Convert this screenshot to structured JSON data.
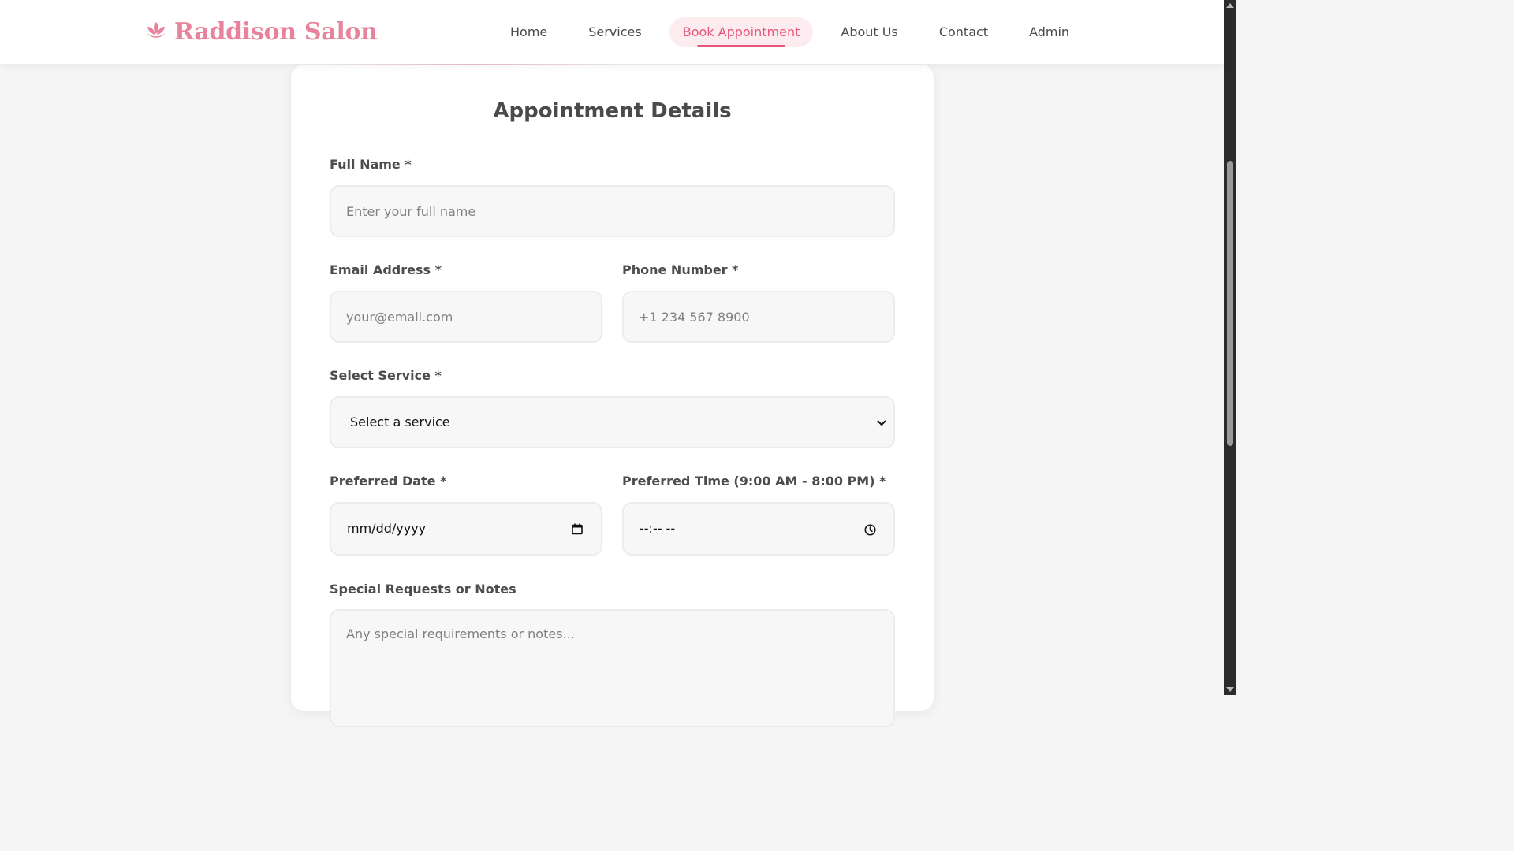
{
  "brand": {
    "name": "Raddison Salon",
    "icon": "lotus-icon",
    "color": "#e8839c"
  },
  "nav": {
    "items": [
      {
        "label": "Home"
      },
      {
        "label": "Services"
      },
      {
        "label": "Book Appointment",
        "active": true
      },
      {
        "label": "About Us"
      },
      {
        "label": "Contact"
      },
      {
        "label": "Admin"
      }
    ],
    "active_color": "#e8577a"
  },
  "form": {
    "title": "Appointment Details",
    "full_name": {
      "label": "Full Name *",
      "placeholder": "Enter your full name",
      "value": ""
    },
    "email": {
      "label": "Email Address *",
      "placeholder": "your@email.com",
      "value": ""
    },
    "phone": {
      "label": "Phone Number *",
      "placeholder": "+1 234 567 8900",
      "value": ""
    },
    "service": {
      "label": "Select Service *",
      "selected": "Select a service"
    },
    "date": {
      "label": "Preferred Date *",
      "display": "mm/dd/yyyy"
    },
    "time": {
      "label": "Preferred Time (9:00 AM - 8:00 PM) *",
      "display": "--:-- --"
    },
    "notes": {
      "label": "Special Requests or Notes",
      "placeholder": "Any special requirements or notes...",
      "value": ""
    }
  }
}
